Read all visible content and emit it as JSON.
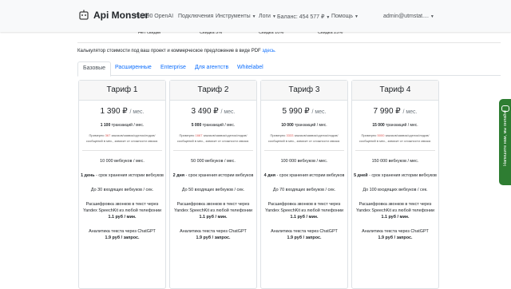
{
  "navbar": {
    "brand": "Api Monster",
    "order": "#16190 OpenAI",
    "connections": "Подключения",
    "tools": "Инструменты",
    "logs": "Логи",
    "balance": "Баланс: 454 577 ₽",
    "help": "Помощь",
    "user": "admin@utmstat...."
  },
  "top_strip": [
    "Нет скидки",
    "Скидка 5%",
    "Скидка 10%",
    "Скидка 25%"
  ],
  "calculator": {
    "text": "Калькулятор стоимости под ваш проект и коммерческое предложение в виде PDF",
    "link": "здесь."
  },
  "tabs": [
    "Базовые",
    "Расширенные",
    "Enterprise",
    "Для агентств",
    "Whitelabel"
  ],
  "plans": [
    {
      "title": "Тариф 1",
      "price": "1 390 ₽",
      "per": "/ мес.",
      "tx": "1 100",
      "tx_label": "транзакций / мес.",
      "ex_pre": "Примерно",
      "ex_num": "367",
      "ex_post": "заказов/заявок/сделок/лидов/сообщений в мес., зависит от сложности связки.",
      "webhooks": "10 000 вебхуков / мес.",
      "storage_days": "1 день",
      "storage_rest": "- срок хранения истории вебхуков",
      "incoming": "До 30 входящих вебхуков / сек.",
      "speech": "Расшифровка звонков в текст через Yandex SpeechKit из любой телефонии",
      "speech_price": "1.1 руб / мин.",
      "gpt": "Аналитика текста через ChatGPT",
      "gpt_price": "1.9 руб / запрос."
    },
    {
      "title": "Тариф 2",
      "price": "3 490 ₽",
      "per": "/ мес.",
      "tx": "5 000",
      "tx_label": "транзакций / мес.",
      "ex_pre": "Примерно",
      "ex_num": "1667",
      "ex_post": "заказов/заявок/сделок/лидов/сообщений в мес., зависит от сложности связки.",
      "webhooks": "50 000 вебхуков / мес.",
      "storage_days": "2 дня",
      "storage_rest": "- срок хранения истории вебхуков",
      "incoming": "До 50 входящих вебхуков / сек.",
      "speech": "Расшифровка звонков в текст через Yandex SpeechKit из любой телефонии",
      "speech_price": "1.1 руб / мин.",
      "gpt": "Аналитика текста через ChatGPT",
      "gpt_price": "1.9 руб / запрос."
    },
    {
      "title": "Тариф 3",
      "price": "5 990 ₽",
      "per": "/ мес.",
      "tx": "10 000",
      "tx_label": "транзакций / мес.",
      "ex_pre": "Примерно",
      "ex_num": "3333",
      "ex_post": "заказов/заявок/сделок/лидов/сообщений в мес., зависит от сложности связки.",
      "webhooks": "100 000 вебхуков / мес.",
      "storage_days": "4 дня",
      "storage_rest": "- срок хранения истории вебхуков",
      "incoming": "До 70 входящих вебхуков / сек.",
      "speech": "Расшифровка звонков в текст через Yandex SpeechKit из любой телефонии",
      "speech_price": "1.1 руб / мин.",
      "gpt": "Аналитика текста через ChatGPT",
      "gpt_price": "1.9 руб / запрос."
    },
    {
      "title": "Тариф 4",
      "price": "7 990 ₽",
      "per": "/ мес.",
      "tx": "15 000",
      "tx_label": "транзакций / мес.",
      "ex_pre": "Примерно",
      "ex_num": "5000",
      "ex_post": "заказов/заявок/сделок/лидов/сообщений в мес., зависит от сложности связки.",
      "webhooks": "150 000 вебхуков / мес.",
      "storage_days": "5 дней",
      "storage_rest": "- срок хранения истории вебхуков",
      "incoming": "До 100 входящих вебхуков / сек.",
      "speech": "Расшифровка звонков в текст через Yandex SpeechKit из любой телефонии",
      "speech_price": "1.1 руб / мин.",
      "gpt": "Аналитика текста через ChatGPT",
      "gpt_price": "1.9 руб / запрос."
    }
  ],
  "chat_widget": "Напишите нам, мы онлайн!",
  "colors": {
    "accent": "#0d6efd",
    "highlight": "#d9534f",
    "chat": "#2e7d32"
  }
}
